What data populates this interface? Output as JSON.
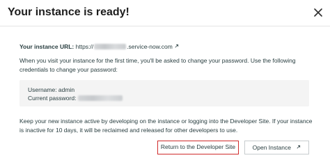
{
  "modal": {
    "title": "Your instance is ready!",
    "url_label": "Your instance URL:",
    "url_prefix": "https://",
    "url_suffix": ".service-now.com",
    "intro_text": "When you visit your instance for the first time, you'll be asked to change your password. Use the following credentials to change your password:",
    "credentials": {
      "username_line": "Username: admin",
      "password_label": "Current password:"
    },
    "footer_text": "Keep your new instance active by developing on the instance or logging into the Developer Site. If your instance is inactive for 10 days, it will be reclaimed and released for other developers to use.",
    "buttons": {
      "return_label": "Return to the Developer Site",
      "open_label": "Open Instance"
    }
  },
  "colors": {
    "highlight_border": "#d02b2b",
    "text": "#293e40",
    "credentials_bg": "#f4f4f4"
  }
}
